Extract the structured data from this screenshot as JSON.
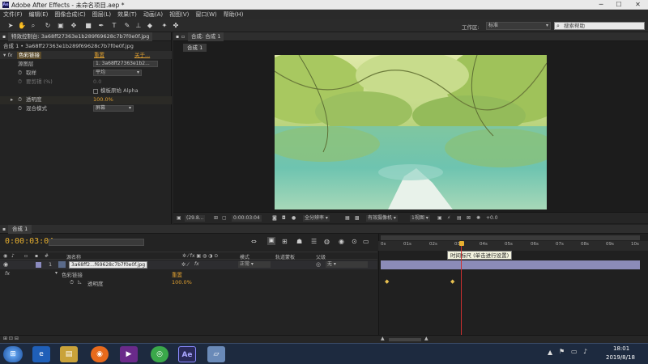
{
  "titlebar": {
    "app_icon": "Ae",
    "title": "Adobe After Effects - 未命名项目.aep *",
    "minimize": "─",
    "maximize": "☐",
    "close": "✕"
  },
  "menu": [
    "文件(F)",
    "编辑(E)",
    "图像合成(C)",
    "图层(L)",
    "效果(T)",
    "动画(A)",
    "视图(V)",
    "窗口(W)",
    "帮助(H)"
  ],
  "toolbar": {
    "workspace_label": "工作区:",
    "workspace_value": "标准",
    "search_placeholder": "搜索帮助"
  },
  "effect_controls": {
    "tab": "特效控制台: 3a68ff27363e1b289f69628c7b7f0e0f.jpg",
    "subtitle": "合成 1 • 3a68ff27363e1b289f69628c7b7f0e0f.jpg",
    "effect_name": "色彩链接",
    "reset": "重置",
    "about": "关于...",
    "source_layer_label": "源图层",
    "source_layer_value": "1. 3a68ff27363e1b2...",
    "sample_label": "取样",
    "sample_value": "平均",
    "clip_label": "要剪辑 (%)",
    "clip_value": "0.0",
    "stencil_label": "模板原始 Alpha",
    "opacity_label": "透明度",
    "opacity_value": "100.0%",
    "blend_label": "混合模式",
    "blend_value": "屏幕"
  },
  "composition": {
    "tab": "合成: 合成 1",
    "comp_tab": "合成 1",
    "zoom": "(29.8...",
    "timecode": "0:00:03:04",
    "resolution": "全分辨率",
    "camera": "有效摄像机",
    "views": "1视图",
    "exposure": "+0.0"
  },
  "timeline": {
    "tab": "合成 1",
    "timecode": "0:00:03:04",
    "col_source": "源名称",
    "col_mode": "模式",
    "col_trkmat": "轨道蒙板",
    "col_parent": "父级",
    "layer_num": "1",
    "layer_name": "3a68ff2...f69628c7b7f0e0f.jpg",
    "layer_mode": "正常",
    "layer_parent": "无",
    "fx_name": "色彩链接",
    "fx_reset": "重置",
    "fx_prop": "透明度",
    "fx_prop_value": "100.0%",
    "ruler": [
      "0s",
      "01s",
      "02s",
      "03s",
      "04s",
      "05s",
      "06s",
      "07s",
      "08s",
      "09s",
      "10s"
    ],
    "tooltip": "时间标尺 (单击进行设置)"
  },
  "taskbar": {
    "ae_label": "Ae",
    "time": "18:01",
    "date": "2019/8/18"
  },
  "colors": {
    "timecode": "#e8b030",
    "accent_orange": "#e0a030",
    "playhead": "#d03030",
    "layer_bar": "#8b8bb8"
  }
}
